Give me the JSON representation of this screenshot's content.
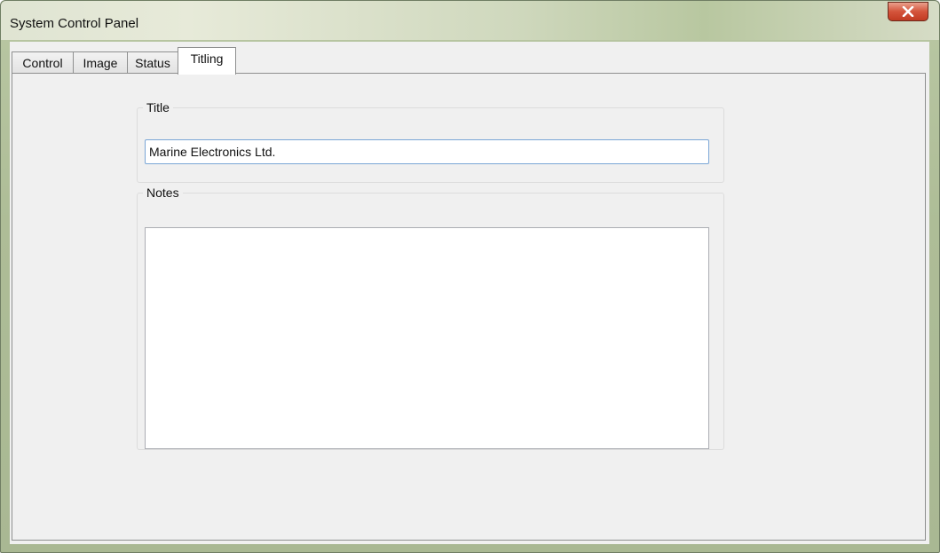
{
  "window": {
    "title": "System Control Panel"
  },
  "tabs": [
    {
      "label": "Control",
      "active": false
    },
    {
      "label": "Image",
      "active": false
    },
    {
      "label": "Status",
      "active": false
    },
    {
      "label": "Titling",
      "active": true
    }
  ],
  "title_group": {
    "label": "Title",
    "value": "Marine Electronics Ltd."
  },
  "notes_group": {
    "label": "Notes",
    "value": ""
  },
  "colors": {
    "frame": "#aebd97",
    "client": "#f0f0f0",
    "close_button": "#c94a32",
    "input_border_focus": "#7aa6d6"
  },
  "icons": {
    "close": "close-icon"
  }
}
